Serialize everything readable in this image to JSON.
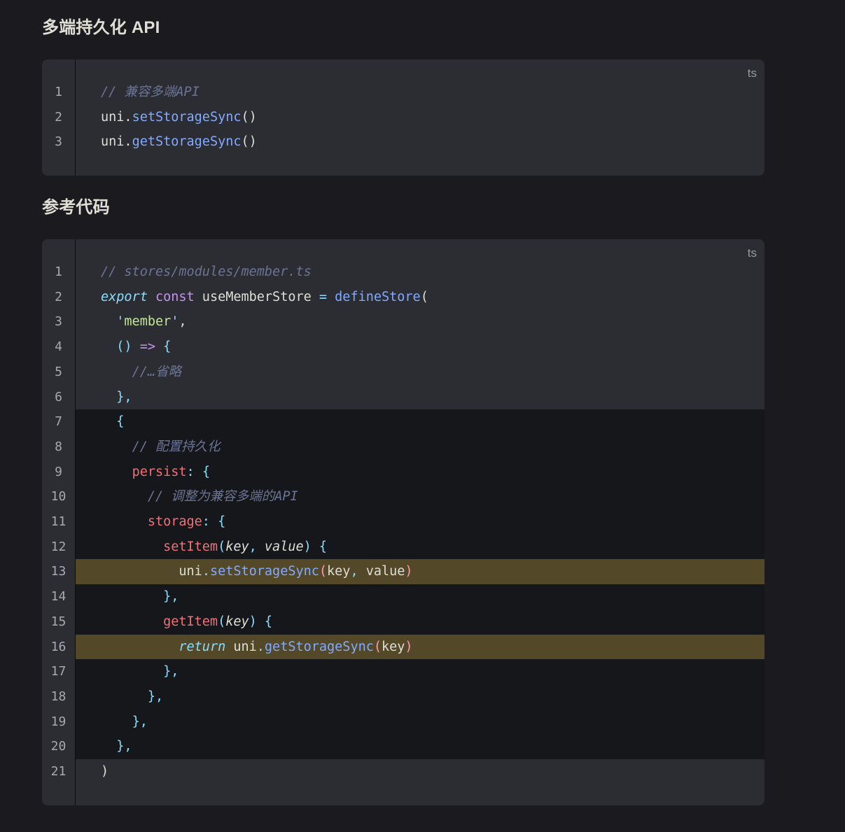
{
  "sections": [
    {
      "heading": "多端持久化 API",
      "lang": "ts",
      "lines": [
        [
          {
            "t": "// 兼容多端API",
            "c": "cmt"
          }
        ],
        [
          {
            "t": "uni",
            "c": "pl"
          },
          {
            "t": ".",
            "c": "pl"
          },
          {
            "t": "setStorageSync",
            "c": "fn"
          },
          {
            "t": "()",
            "c": "pl"
          }
        ],
        [
          {
            "t": "uni",
            "c": "pl"
          },
          {
            "t": ".",
            "c": "pl"
          },
          {
            "t": "getStorageSync",
            "c": "fn"
          },
          {
            "t": "()",
            "c": "pl"
          }
        ]
      ]
    },
    {
      "heading": "参考代码",
      "lang": "ts",
      "dim_lines": [
        7,
        8,
        9,
        10,
        11,
        12,
        14,
        15,
        17,
        18,
        19,
        20
      ],
      "highlight_lines": [
        13,
        16
      ],
      "lines": [
        [
          {
            "t": "// stores/modules/member.ts",
            "c": "cmt"
          }
        ],
        [
          {
            "t": "export",
            "c": "exp"
          },
          {
            "t": " ",
            "c": "pl"
          },
          {
            "t": "const",
            "c": "kw"
          },
          {
            "t": " useMemberStore ",
            "c": "pl"
          },
          {
            "t": "=",
            "c": "op"
          },
          {
            "t": " ",
            "c": "pl"
          },
          {
            "t": "defineStore",
            "c": "fn"
          },
          {
            "t": "(",
            "c": "pl"
          }
        ],
        [
          {
            "t": "  ",
            "c": "pl"
          },
          {
            "t": "'",
            "c": "pun"
          },
          {
            "t": "member",
            "c": "str"
          },
          {
            "t": "'",
            "c": "pun"
          },
          {
            "t": ",",
            "c": "pl"
          }
        ],
        [
          {
            "t": "  ",
            "c": "pl"
          },
          {
            "t": "()",
            "c": "pun"
          },
          {
            "t": " ",
            "c": "pl"
          },
          {
            "t": "=>",
            "c": "kw"
          },
          {
            "t": " ",
            "c": "pl"
          },
          {
            "t": "{",
            "c": "pun"
          }
        ],
        [
          {
            "t": "    ",
            "c": "pl"
          },
          {
            "t": "//…省略",
            "c": "cmt"
          }
        ],
        [
          {
            "t": "  ",
            "c": "pl"
          },
          {
            "t": "},",
            "c": "pun"
          }
        ],
        [
          {
            "t": "  ",
            "c": "pl"
          },
          {
            "t": "{",
            "c": "pun"
          }
        ],
        [
          {
            "t": "    ",
            "c": "pl"
          },
          {
            "t": "// 配置持久化",
            "c": "cmt"
          }
        ],
        [
          {
            "t": "    ",
            "c": "pl"
          },
          {
            "t": "persist",
            "c": "prop"
          },
          {
            "t": ":",
            "c": "pun"
          },
          {
            "t": " ",
            "c": "pl"
          },
          {
            "t": "{",
            "c": "pun"
          }
        ],
        [
          {
            "t": "      ",
            "c": "pl"
          },
          {
            "t": "// 调整为兼容多端的API",
            "c": "cmt"
          }
        ],
        [
          {
            "t": "      ",
            "c": "pl"
          },
          {
            "t": "storage",
            "c": "prop"
          },
          {
            "t": ":",
            "c": "pun"
          },
          {
            "t": " ",
            "c": "pl"
          },
          {
            "t": "{",
            "c": "pun"
          }
        ],
        [
          {
            "t": "        ",
            "c": "pl"
          },
          {
            "t": "setItem",
            "c": "prop"
          },
          {
            "t": "(",
            "c": "pun"
          },
          {
            "t": "key",
            "c": "par"
          },
          {
            "t": ",",
            "c": "pun"
          },
          {
            "t": " ",
            "c": "pl"
          },
          {
            "t": "value",
            "c": "par"
          },
          {
            "t": ")",
            "c": "pun"
          },
          {
            "t": " ",
            "c": "pl"
          },
          {
            "t": "{",
            "c": "pun"
          }
        ],
        [
          {
            "t": "          ",
            "c": "pl"
          },
          {
            "t": "uni",
            "c": "pl"
          },
          {
            "t": ".",
            "c": "pun"
          },
          {
            "t": "setStorageSync",
            "c": "fn"
          },
          {
            "t": "(",
            "c": "brk"
          },
          {
            "t": "key",
            "c": "pl"
          },
          {
            "t": ",",
            "c": "pun"
          },
          {
            "t": " value",
            "c": "pl"
          },
          {
            "t": ")",
            "c": "brk"
          }
        ],
        [
          {
            "t": "        ",
            "c": "pl"
          },
          {
            "t": "},",
            "c": "pun"
          }
        ],
        [
          {
            "t": "        ",
            "c": "pl"
          },
          {
            "t": "getItem",
            "c": "prop"
          },
          {
            "t": "(",
            "c": "pun"
          },
          {
            "t": "key",
            "c": "par"
          },
          {
            "t": ")",
            "c": "pun"
          },
          {
            "t": " ",
            "c": "pl"
          },
          {
            "t": "{",
            "c": "pun"
          }
        ],
        [
          {
            "t": "          ",
            "c": "pl"
          },
          {
            "t": "return",
            "c": "ret"
          },
          {
            "t": " uni",
            "c": "pl"
          },
          {
            "t": ".",
            "c": "pun"
          },
          {
            "t": "getStorageSync",
            "c": "fn"
          },
          {
            "t": "(",
            "c": "brk"
          },
          {
            "t": "key",
            "c": "pl"
          },
          {
            "t": ")",
            "c": "brk"
          }
        ],
        [
          {
            "t": "        ",
            "c": "pl"
          },
          {
            "t": "},",
            "c": "pun"
          }
        ],
        [
          {
            "t": "      ",
            "c": "pl"
          },
          {
            "t": "},",
            "c": "pun"
          }
        ],
        [
          {
            "t": "    ",
            "c": "pl"
          },
          {
            "t": "},",
            "c": "pun"
          }
        ],
        [
          {
            "t": "  ",
            "c": "pl"
          },
          {
            "t": "},",
            "c": "pun"
          }
        ],
        [
          {
            "t": ")",
            "c": "pl"
          }
        ]
      ]
    }
  ]
}
